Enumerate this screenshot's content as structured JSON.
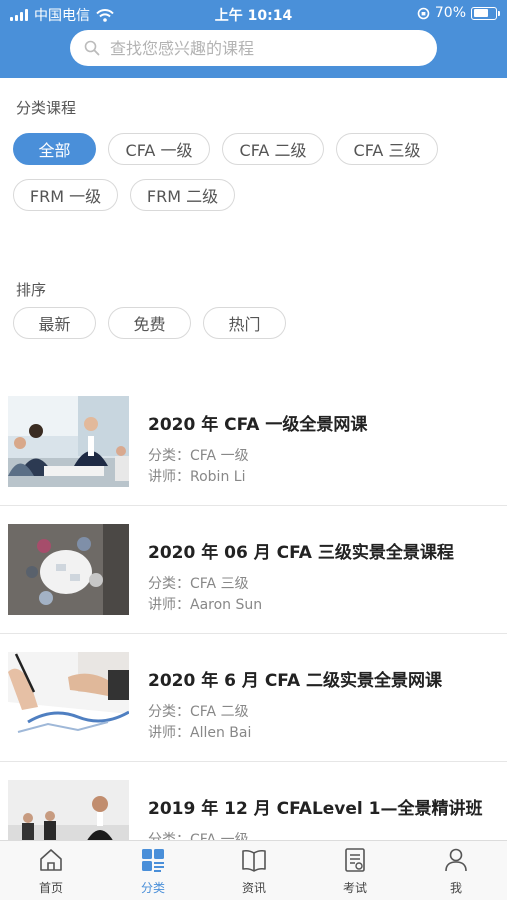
{
  "status_bar": {
    "carrier": "中国电信",
    "time": "上午 10:14",
    "battery": "70%"
  },
  "search": {
    "placeholder": "查找您感兴趣的课程"
  },
  "filters": {
    "category_label": "分类课程",
    "categories": [
      {
        "label": "全部",
        "active": true
      },
      {
        "label": "CFA 一级",
        "active": false
      },
      {
        "label": "CFA 二级",
        "active": false
      },
      {
        "label": "CFA 三级",
        "active": false
      },
      {
        "label": "FRM 一级",
        "active": false
      },
      {
        "label": "FRM 二级",
        "active": false
      }
    ],
    "sort_label": "排序",
    "sorts": [
      {
        "label": "最新"
      },
      {
        "label": "免费"
      },
      {
        "label": "热门"
      }
    ]
  },
  "courses": [
    {
      "title": "2020 年 CFA 一级全景网课",
      "category": "分类：CFA 一级",
      "teacher": "讲师：Robin Li"
    },
    {
      "title": "2020 年 06 月 CFA 三级实景全景课程",
      "category": "分类：CFA 三级",
      "teacher": "讲师：Aaron Sun"
    },
    {
      "title": "2020 年 6 月 CFA 二级实景全景网课",
      "category": "分类：CFA 二级",
      "teacher": "讲师：Allen Bai"
    },
    {
      "title": "2019 年 12 月 CFALevel 1—全景精讲班",
      "category": "分类：CFA 一级",
      "teacher": ""
    }
  ],
  "tabbar": {
    "items": [
      {
        "label": "首页",
        "icon": "home-icon",
        "active": false
      },
      {
        "label": "分类",
        "icon": "category-icon",
        "active": true
      },
      {
        "label": "资讯",
        "icon": "book-icon",
        "active": false
      },
      {
        "label": "考试",
        "icon": "exam-icon",
        "active": false
      },
      {
        "label": "我",
        "icon": "user-icon",
        "active": false
      }
    ]
  },
  "colors": {
    "primary": "#4a8fd9",
    "header_bg": "#4a90d9"
  }
}
